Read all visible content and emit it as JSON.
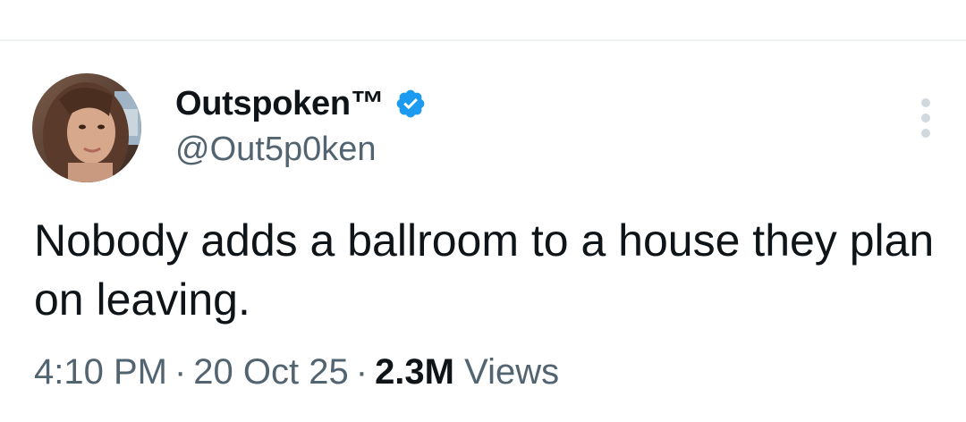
{
  "author": {
    "display_name": "Outspoken™",
    "handle": "@Out5p0ken",
    "verified": true,
    "verified_color": "#1d9bf0",
    "avatar_icon": "profile-photo"
  },
  "tweet": {
    "text": "Nobody adds a ballroom to a house they plan on leaving."
  },
  "meta": {
    "time": "4:10 PM",
    "separator": "·",
    "date": "20 Oct 25",
    "views_count": "2.3M",
    "views_label": "Views"
  },
  "actions": {
    "more_icon": "more-vertical-icon"
  },
  "colors": {
    "text_primary": "#0f1419",
    "text_secondary": "#536471",
    "divider": "#eff3f4",
    "icon_muted": "#cfd9de"
  }
}
